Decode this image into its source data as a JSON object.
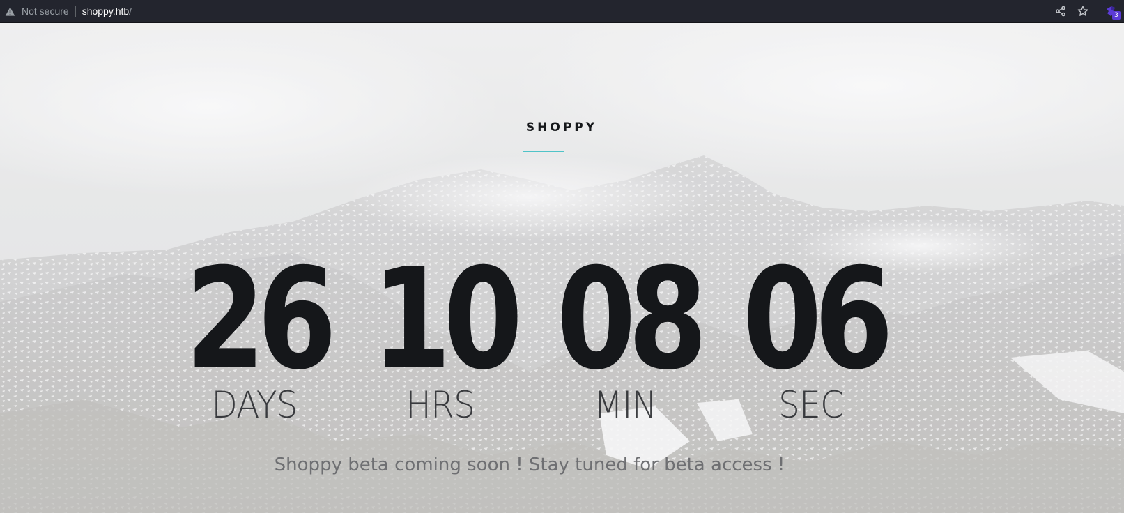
{
  "browser": {
    "security_label": "Not secure",
    "url_host": "shoppy.htb",
    "url_path": "/",
    "extension_badge_count": "3",
    "icons": [
      "warning-icon",
      "share-icon",
      "star-icon",
      "extension-icon"
    ]
  },
  "site": {
    "brand": "SHOPPY",
    "accent_color": "#4fc3c8",
    "countdown": [
      {
        "value": "26",
        "unit": "DAYS"
      },
      {
        "value": "10",
        "unit": "HRS"
      },
      {
        "value": "08",
        "unit": "MIN"
      },
      {
        "value": "06",
        "unit": "SEC"
      }
    ],
    "tagline": "Shoppy beta coming soon ! Stay tuned for beta access !"
  }
}
